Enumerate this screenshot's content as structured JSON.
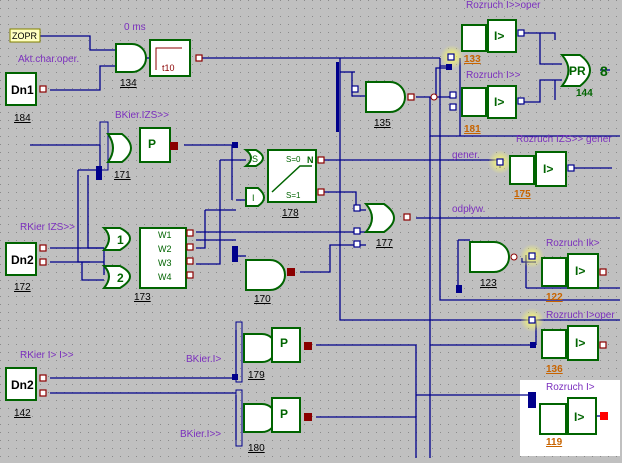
{
  "labels": {
    "zopr": "ZOPR",
    "zero_ms": "0 ms",
    "akt_char": "Akt.char.oper.",
    "bkier_izs": "BKier.IZS>>",
    "rkier_izs": "RKier IZS>>",
    "rkier_ii": "RKier I> I>>",
    "bkier_i": "BKier.I>",
    "bkier_ii": "BKier.I>>",
    "gener": "gener.",
    "odplyw": "odpływ.",
    "rozruch_ii_oper": "Rozruch I>>oper",
    "rozruch_ii": "Rozruch I>>",
    "rozruch_izs_gener": "Rozruch IZS>> gener",
    "rozruch_ik": "Rozruch Ik>",
    "rozruch_i_oper": "Rozruch I>oper",
    "rozruch_i": "Rozruch I>"
  },
  "blocks": {
    "dn1": {
      "text": "Dn1",
      "num": "184"
    },
    "dn2a": {
      "text": "Dn2",
      "num": "172"
    },
    "dn2b": {
      "text": "Dn2",
      "num": "142"
    },
    "timer": {
      "text": "t10",
      "num": "134"
    },
    "and135": "135",
    "p171": {
      "text": "P",
      "num": "171"
    },
    "sr178": {
      "s": "S",
      "i": "I",
      "s0": "S=0",
      "s1": "S=1",
      "n": "N",
      "num": "178"
    },
    "or177": "177",
    "mux173": {
      "in1": "1",
      "in2": "2",
      "w1": "W1",
      "w2": "W2",
      "w3": "W3",
      "w4": "W4",
      "num": "173"
    },
    "and170": "170",
    "and123": "123",
    "p179": {
      "text": "P",
      "num": "179"
    },
    "p180": {
      "text": "P",
      "num": "180"
    },
    "pr144": {
      "text": "PR",
      "num": "144"
    },
    "r133": {
      "text": "I>",
      "num": "133"
    },
    "r181": {
      "text": "I>",
      "num": "181"
    },
    "r175": {
      "text": "I>",
      "num": "175"
    },
    "r122": {
      "text": "I>",
      "num": "122"
    },
    "r136": {
      "text": "I>",
      "num": "136"
    },
    "r119": {
      "text": "I>",
      "num": "119"
    }
  },
  "colors": {
    "background": "#c0c0c0",
    "wire": "#00008b",
    "gate_outline": "#006400",
    "label_text": "#7b2fbe",
    "block_number_orange": "#c86400",
    "selection_highlight": "#ffffff"
  }
}
